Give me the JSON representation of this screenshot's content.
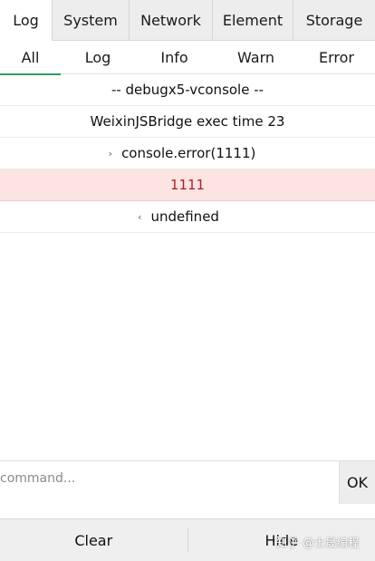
{
  "main_tabs": [
    {
      "label": "Log",
      "active": true
    },
    {
      "label": "System",
      "active": false
    },
    {
      "label": "Network",
      "active": false
    },
    {
      "label": "Element",
      "active": false
    },
    {
      "label": "Storage",
      "active": false
    }
  ],
  "sub_tabs": [
    {
      "label": "All",
      "active": true
    },
    {
      "label": "Log",
      "active": false
    },
    {
      "label": "Info",
      "active": false
    },
    {
      "label": "Warn",
      "active": false
    },
    {
      "label": "Error",
      "active": false
    }
  ],
  "log_rows": [
    {
      "text": "-- debugx5-vconsole --",
      "type": "log"
    },
    {
      "text": "WeixinJSBridge exec time 23",
      "type": "log"
    },
    {
      "text": "console.error(1111)",
      "type": "input",
      "arrow": "›"
    },
    {
      "text": "1111",
      "type": "error"
    },
    {
      "text": "undefined",
      "type": "output",
      "arrow": "‹"
    }
  ],
  "command": {
    "placeholder": "command...",
    "value": "",
    "ok_label": "OK"
  },
  "bottom": {
    "clear_label": "Clear",
    "hide_label": "Hide"
  },
  "watermark": "知乎 @士晟编程",
  "colors": {
    "accent": "#2b9d62",
    "error_bg": "#fde3e2",
    "error_text": "#a1262e"
  }
}
